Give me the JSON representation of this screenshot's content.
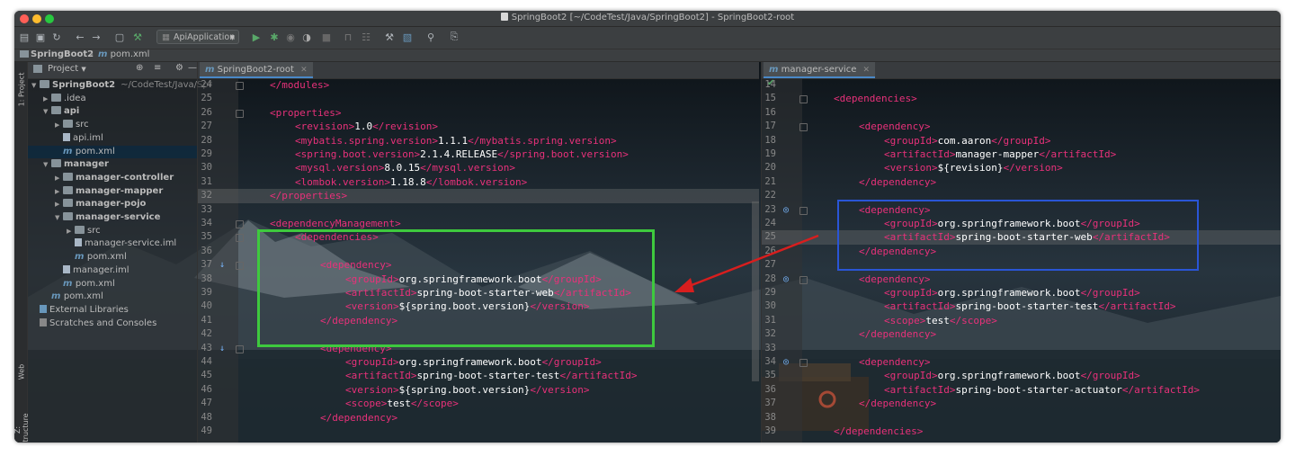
{
  "window": {
    "title": "SpringBoot2 [~/CodeTest/Java/SpringBoot2] - SpringBoot2-root",
    "traffic_colors": [
      "#ff5f57",
      "#febc2e",
      "#28c840"
    ]
  },
  "toolbar": {
    "run_config": "ApiApplication",
    "icons": [
      "folder-open-icon",
      "save-icon",
      "sync-icon",
      "back-icon",
      "forward-icon",
      "project-structure-icon",
      "build-icon",
      "run-icon",
      "debug-icon",
      "coverage-icon",
      "profile-icon",
      "stop-icon",
      "attach-icon",
      "ant-icon",
      "wrench-icon",
      "sdk-icon",
      "search-icon",
      "vcs-icon"
    ]
  },
  "navbar": {
    "crumbs": [
      "SpringBoot2",
      "pom.xml"
    ]
  },
  "sidebar": {
    "labels": [
      "1: Project",
      "Web",
      "Z: Structure"
    ]
  },
  "project_panel": {
    "header": "Project",
    "tree": [
      {
        "label": "SpringBoot2",
        "suffix": "~/CodeTest/Java/Spr",
        "kind": "folder",
        "level": 0,
        "expanded": true,
        "bold": true
      },
      {
        "label": ".idea",
        "kind": "folder",
        "level": 1,
        "expanded": false
      },
      {
        "label": "api",
        "kind": "folder",
        "level": 1,
        "expanded": true,
        "bold": true
      },
      {
        "label": "src",
        "kind": "folder",
        "level": 2,
        "expanded": false
      },
      {
        "label": "api.iml",
        "kind": "file",
        "level": 2
      },
      {
        "label": "pom.xml",
        "kind": "maven",
        "level": 2,
        "selected": true
      },
      {
        "label": "manager",
        "kind": "folder",
        "level": 1,
        "expanded": true,
        "bold": true
      },
      {
        "label": "manager-controller",
        "kind": "folder",
        "level": 2,
        "expanded": false,
        "bold": true
      },
      {
        "label": "manager-mapper",
        "kind": "folder",
        "level": 2,
        "expanded": false,
        "bold": true
      },
      {
        "label": "manager-pojo",
        "kind": "folder",
        "level": 2,
        "expanded": false,
        "bold": true
      },
      {
        "label": "manager-service",
        "kind": "folder",
        "level": 2,
        "expanded": true,
        "bold": true
      },
      {
        "label": "src",
        "kind": "folder",
        "level": 3,
        "expanded": false
      },
      {
        "label": "manager-service.iml",
        "kind": "file",
        "level": 3
      },
      {
        "label": "pom.xml",
        "kind": "maven",
        "level": 3
      },
      {
        "label": "manager.iml",
        "kind": "file",
        "level": 2
      },
      {
        "label": "pom.xml",
        "kind": "maven",
        "level": 2
      },
      {
        "label": "pom.xml",
        "kind": "maven",
        "level": 1
      },
      {
        "label": "External Libraries",
        "kind": "lib",
        "level": 0
      },
      {
        "label": "Scratches and Consoles",
        "kind": "scratch",
        "level": 0
      }
    ]
  },
  "editor_left": {
    "tab": "SpringBoot2-root",
    "lines": [
      {
        "n": "24",
        "indent": 0,
        "parts": [
          [
            "tag",
            "&lt;/modules&gt;"
          ]
        ]
      },
      {
        "n": "25",
        "indent": 0,
        "parts": []
      },
      {
        "n": "26",
        "indent": 0,
        "parts": [
          [
            "tag",
            "<properties>"
          ]
        ]
      },
      {
        "n": "27",
        "indent": 1,
        "parts": [
          [
            "tag",
            "<revision>"
          ],
          [
            "val",
            "1.0"
          ],
          [
            "tag",
            "</revision>"
          ]
        ]
      },
      {
        "n": "28",
        "indent": 1,
        "parts": [
          [
            "tag",
            "<mybatis.spring.version>"
          ],
          [
            "val",
            "1.1.1"
          ],
          [
            "tag",
            "</mybatis.spring.version>"
          ]
        ]
      },
      {
        "n": "29",
        "indent": 1,
        "parts": [
          [
            "tag",
            "<spring.boot.version>"
          ],
          [
            "val",
            "2.1.4.RELEASE"
          ],
          [
            "tag",
            "</spring.boot.version>"
          ]
        ]
      },
      {
        "n": "30",
        "indent": 1,
        "parts": [
          [
            "tag",
            "<mysql.version>"
          ],
          [
            "val",
            "8.0.15"
          ],
          [
            "tag",
            "</mysql.version>"
          ]
        ]
      },
      {
        "n": "31",
        "indent": 1,
        "parts": [
          [
            "tag",
            "<lombok.version>"
          ],
          [
            "val",
            "1.18.8"
          ],
          [
            "tag",
            "</lombok.version>"
          ]
        ]
      },
      {
        "n": "32",
        "indent": 0,
        "parts": [
          [
            "tag",
            "</properties>"
          ]
        ],
        "highlight": true
      },
      {
        "n": "33",
        "indent": 0,
        "parts": []
      },
      {
        "n": "34",
        "indent": 0,
        "parts": [
          [
            "tag",
            "<dependencyManagement>"
          ]
        ]
      },
      {
        "n": "35",
        "indent": 1,
        "parts": [
          [
            "tag",
            "<dependencies>"
          ]
        ]
      },
      {
        "n": "36",
        "indent": 0,
        "parts": []
      },
      {
        "n": "37",
        "indent": 2,
        "parts": [
          [
            "tag",
            "<dependency>"
          ]
        ],
        "gicon": "implemented-icon"
      },
      {
        "n": "38",
        "indent": 3,
        "parts": [
          [
            "tag",
            "<groupId>"
          ],
          [
            "val",
            "org.springframework.boot"
          ],
          [
            "tag",
            "</groupId>"
          ]
        ]
      },
      {
        "n": "39",
        "indent": 3,
        "parts": [
          [
            "tag",
            "<artifactId>"
          ],
          [
            "val",
            "spring-boot-starter-web"
          ],
          [
            "tag",
            "</artifactId>"
          ]
        ]
      },
      {
        "n": "40",
        "indent": 3,
        "parts": [
          [
            "tag",
            "<version>"
          ],
          [
            "val",
            "${spring.boot.version}"
          ],
          [
            "tag",
            "</version>"
          ]
        ]
      },
      {
        "n": "41",
        "indent": 2,
        "parts": [
          [
            "tag",
            "</dependency>"
          ]
        ]
      },
      {
        "n": "42",
        "indent": 0,
        "parts": []
      },
      {
        "n": "43",
        "indent": 2,
        "parts": [
          [
            "tag",
            "<dependency>"
          ]
        ],
        "gicon": "implemented-icon"
      },
      {
        "n": "44",
        "indent": 3,
        "parts": [
          [
            "tag",
            "<groupId>"
          ],
          [
            "val",
            "org.springframework.boot"
          ],
          [
            "tag",
            "</groupId>"
          ]
        ]
      },
      {
        "n": "45",
        "indent": 3,
        "parts": [
          [
            "tag",
            "<artifactId>"
          ],
          [
            "val",
            "spring-boot-starter-test"
          ],
          [
            "tag",
            "</artifactId>"
          ]
        ]
      },
      {
        "n": "46",
        "indent": 3,
        "parts": [
          [
            "tag",
            "<version>"
          ],
          [
            "val",
            "${spring.boot.version}"
          ],
          [
            "tag",
            "</version>"
          ]
        ]
      },
      {
        "n": "47",
        "indent": 3,
        "parts": [
          [
            "tag",
            "<scope>"
          ],
          [
            "val",
            "test"
          ],
          [
            "tag",
            "</scope>"
          ]
        ]
      },
      {
        "n": "48",
        "indent": 2,
        "parts": [
          [
            "tag",
            "</dependency>"
          ]
        ]
      },
      {
        "n": "49",
        "indent": 0,
        "parts": []
      }
    ]
  },
  "editor_right": {
    "tab": "manager-service",
    "lines": [
      {
        "n": "14",
        "indent": 0,
        "parts": []
      },
      {
        "n": "15",
        "indent": 0,
        "parts": [
          [
            "tag",
            "<dependencies>"
          ]
        ]
      },
      {
        "n": "16",
        "indent": 0,
        "parts": []
      },
      {
        "n": "17",
        "indent": 1,
        "parts": [
          [
            "tag",
            "<dependency>"
          ]
        ]
      },
      {
        "n": "18",
        "indent": 2,
        "parts": [
          [
            "tag",
            "<groupId>"
          ],
          [
            "val",
            "com.aaron"
          ],
          [
            "tag",
            "</groupId>"
          ]
        ]
      },
      {
        "n": "19",
        "indent": 2,
        "parts": [
          [
            "tag",
            "<artifactId>"
          ],
          [
            "val",
            "manager-mapper"
          ],
          [
            "tag",
            "</artifactId>"
          ]
        ]
      },
      {
        "n": "20",
        "indent": 2,
        "parts": [
          [
            "tag",
            "<version>"
          ],
          [
            "val",
            "${revision}"
          ],
          [
            "tag",
            "</version>"
          ]
        ]
      },
      {
        "n": "21",
        "indent": 1,
        "parts": [
          [
            "tag",
            "</dependency>"
          ]
        ]
      },
      {
        "n": "22",
        "indent": 0,
        "parts": []
      },
      {
        "n": "23",
        "indent": 1,
        "parts": [
          [
            "tag",
            "<dependency>"
          ]
        ],
        "gicon": "override-icon"
      },
      {
        "n": "24",
        "indent": 2,
        "parts": [
          [
            "tag",
            "<groupId>"
          ],
          [
            "val",
            "org.springframework.boot"
          ],
          [
            "tag",
            "</groupId>"
          ]
        ]
      },
      {
        "n": "25",
        "indent": 2,
        "parts": [
          [
            "tag",
            "<artifactId>"
          ],
          [
            "val",
            "spring-boot-starter-web"
          ],
          [
            "tag",
            "</artifactId>"
          ]
        ],
        "highlight": true
      },
      {
        "n": "26",
        "indent": 1,
        "parts": [
          [
            "tag",
            "</dependency>"
          ]
        ]
      },
      {
        "n": "27",
        "indent": 0,
        "parts": []
      },
      {
        "n": "28",
        "indent": 1,
        "parts": [
          [
            "tag",
            "<dependency>"
          ]
        ],
        "gicon": "override-icon"
      },
      {
        "n": "29",
        "indent": 2,
        "parts": [
          [
            "tag",
            "<groupId>"
          ],
          [
            "val",
            "org.springframework.boot"
          ],
          [
            "tag",
            "</groupId>"
          ]
        ]
      },
      {
        "n": "30",
        "indent": 2,
        "parts": [
          [
            "tag",
            "<artifactId>"
          ],
          [
            "val",
            "spring-boot-starter-test"
          ],
          [
            "tag",
            "</artifactId>"
          ]
        ]
      },
      {
        "n": "31",
        "indent": 2,
        "parts": [
          [
            "tag",
            "<scope>"
          ],
          [
            "val",
            "test"
          ],
          [
            "tag",
            "</scope>"
          ]
        ]
      },
      {
        "n": "32",
        "indent": 1,
        "parts": [
          [
            "tag",
            "</dependency>"
          ]
        ]
      },
      {
        "n": "33",
        "indent": 0,
        "parts": []
      },
      {
        "n": "34",
        "indent": 1,
        "parts": [
          [
            "tag",
            "<dependency>"
          ]
        ],
        "gicon": "override-icon"
      },
      {
        "n": "35",
        "indent": 2,
        "parts": [
          [
            "tag",
            "<groupId>"
          ],
          [
            "val",
            "org.springframework.boot"
          ],
          [
            "tag",
            "</groupId>"
          ]
        ]
      },
      {
        "n": "36",
        "indent": 2,
        "parts": [
          [
            "tag",
            "<artifactId>"
          ],
          [
            "val",
            "spring-boot-starter-actuator"
          ],
          [
            "tag",
            "</artifactId>"
          ]
        ]
      },
      {
        "n": "37",
        "indent": 1,
        "parts": [
          [
            "tag",
            "</dependency>"
          ]
        ]
      },
      {
        "n": "38",
        "indent": 0,
        "parts": []
      },
      {
        "n": "39",
        "indent": 0,
        "parts": [
          [
            "tag",
            "</dependencies>"
          ]
        ]
      }
    ]
  },
  "annotations": {
    "green_box_color": "#3ec93e",
    "blue_box_color": "#2a55d6",
    "arrow_color": "#d81e1e"
  }
}
